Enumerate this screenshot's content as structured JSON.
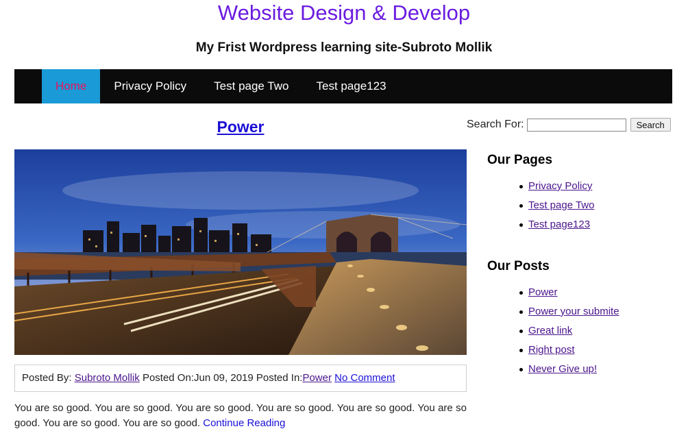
{
  "site": {
    "title": "Website Design & Develop",
    "tagline": "My Frist Wordpress learning site-Subroto Mollik"
  },
  "nav": {
    "items": [
      {
        "label": "Home",
        "active": true
      },
      {
        "label": "Privacy Policy",
        "active": false
      },
      {
        "label": "Test page Two",
        "active": false
      },
      {
        "label": "Test page123",
        "active": false
      }
    ]
  },
  "post": {
    "title": "Power",
    "image": "city-bridge-night-photo",
    "meta": {
      "posted_by_label": "Posted By:",
      "author": "Subroto Mollik",
      "posted_on_label": "Posted On:",
      "date": "Jun 09, 2019",
      "posted_in_label": "Posted In:",
      "category": "Power",
      "comments": "No Comment"
    },
    "excerpt": "You are so good. You are so good. You are so good. You are so good. You are so good. You are so good. You are so good. You are so good.",
    "continue_label": "Continue Reading"
  },
  "search": {
    "label": "Search For:",
    "value": "",
    "button": "Search"
  },
  "sidebar": {
    "pages_title": "Our Pages",
    "pages": [
      "Privacy Policy",
      "Test page Two",
      "Test page123"
    ],
    "posts_title": "Our Posts",
    "posts": [
      "Power",
      "Power your submite",
      "Great link",
      "Right post",
      "Never Give up!"
    ]
  },
  "colors": {
    "title": "#6a1be0",
    "nav_bg": "#0b0b0b",
    "nav_active_bg": "#1a9ad6",
    "nav_active_text": "#e8145f",
    "link": "#4a148c"
  }
}
